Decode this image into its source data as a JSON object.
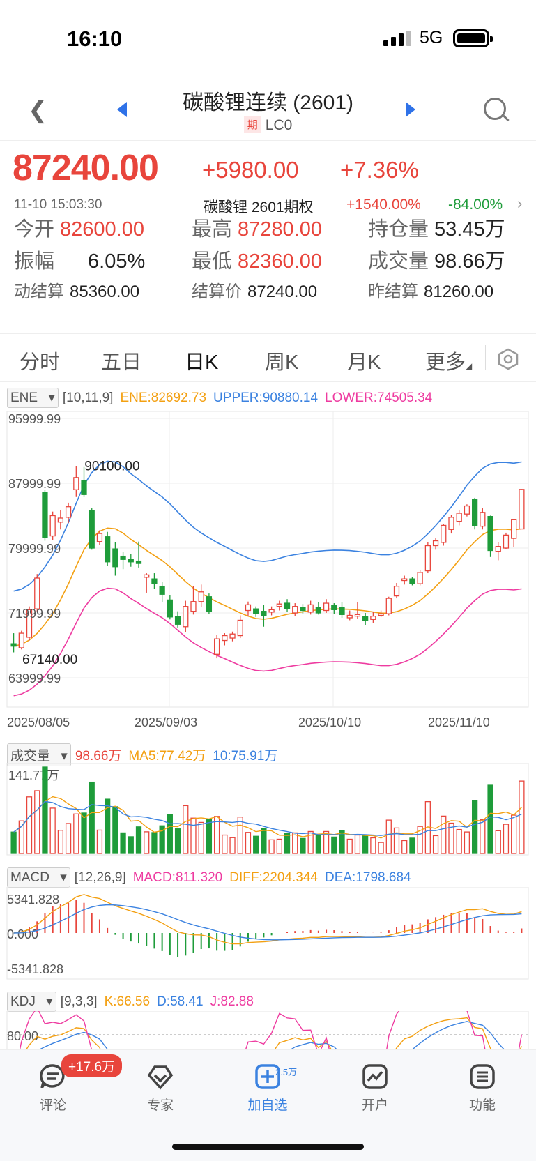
{
  "status_bar": {
    "time": "16:10",
    "network": "5G"
  },
  "header": {
    "title": "碳酸锂连续 (2601)",
    "tag": "期",
    "code": "LC0"
  },
  "quote": {
    "price": "87240.00",
    "change": "+5980.00",
    "change_pct": "+7.36%",
    "timestamp": "11-10 15:03:30",
    "option_name": "碳酸锂 2601期权",
    "option_up": "+1540.00%",
    "option_down": "-84.00%"
  },
  "stats": {
    "open_label": "今开",
    "open": "82600.00",
    "high_label": "最高",
    "high": "87280.00",
    "oi_label": "持仓量",
    "oi": "53.45万",
    "amp_label": "振幅",
    "amp": "6.05%",
    "low_label": "最低",
    "low": "82360.00",
    "vol_label": "成交量",
    "vol": "98.66万",
    "dyn_label": "动结算",
    "dyn": "85360.00",
    "settle_label": "结算价",
    "settle": "87240.00",
    "prev_label": "昨结算",
    "prev": "81260.00"
  },
  "tabs": [
    "分时",
    "五日",
    "日K",
    "周K",
    "月K",
    "更多"
  ],
  "ene": {
    "name": "ENE",
    "params": "[10,11,9]",
    "ene": "ENE:82692.73",
    "upper": "UPPER:90880.14",
    "lower": "LOWER:74505.34",
    "y_labels": [
      "95999.99",
      "87999.99",
      "79999.99",
      "71999.99",
      "63999.99"
    ],
    "max_label": "90100.00",
    "min_label": "67140.00",
    "dates": [
      "2025/08/05",
      "2025/09/03",
      "2025/10/10",
      "2025/11/10"
    ]
  },
  "volume": {
    "name": "成交量",
    "value": "98.66万",
    "ma5": "MA5:77.42万",
    "ma10": "10:75.91万",
    "max_label": "141.77万"
  },
  "macd": {
    "name": "MACD",
    "params": "[12,26,9]",
    "macd": "MACD:811.320",
    "diff": "DIFF:2204.344",
    "dea": "DEA:1798.684",
    "y_labels": [
      "5341.828",
      "0.000",
      "-5341.828"
    ]
  },
  "kdj": {
    "name": "KDJ",
    "params": "[9,3,3]",
    "k": "K:66.56",
    "d": "D:58.41",
    "j": "J:82.88",
    "y_label": "80.00"
  },
  "bottom_nav": {
    "items": [
      "评论",
      "专家",
      "加自选",
      "开户",
      "功能"
    ],
    "comment_badge": "+17.6万",
    "watch_badge": "2.5万"
  },
  "colors": {
    "up": "#e8453c",
    "down": "#1e9c3a",
    "ene": "#f3a012",
    "upper": "#3b82e0",
    "lower": "#ee3ba0",
    "accent": "#2f72e8"
  },
  "chart_data": {
    "type": "candlestick",
    "title": "",
    "ylim": [
      63999.99,
      95999.99
    ],
    "candles": [
      {
        "o": 68200,
        "h": 69500,
        "l": 67140,
        "c": 67900
      },
      {
        "o": 67700,
        "h": 69800,
        "l": 67500,
        "c": 69500
      },
      {
        "o": 69000,
        "h": 72800,
        "l": 68600,
        "c": 72400
      },
      {
        "o": 72500,
        "h": 76800,
        "l": 72100,
        "c": 76300
      },
      {
        "o": 86900,
        "h": 87200,
        "l": 80900,
        "c": 81300
      },
      {
        "o": 81500,
        "h": 84500,
        "l": 81000,
        "c": 84000
      },
      {
        "o": 83200,
        "h": 84700,
        "l": 82300,
        "c": 83700
      },
      {
        "o": 83800,
        "h": 85600,
        "l": 83100,
        "c": 85100
      },
      {
        "o": 87200,
        "h": 90100,
        "l": 86300,
        "c": 88700
      },
      {
        "o": 88300,
        "h": 90000,
        "l": 86300,
        "c": 86600
      },
      {
        "o": 84600,
        "h": 84900,
        "l": 79800,
        "c": 80000
      },
      {
        "o": 80800,
        "h": 82200,
        "l": 80400,
        "c": 81800
      },
      {
        "o": 81400,
        "h": 82000,
        "l": 77800,
        "c": 78300
      },
      {
        "o": 79900,
        "h": 80700,
        "l": 76600,
        "c": 77700
      },
      {
        "o": 79000,
        "h": 79500,
        "l": 77400,
        "c": 78600
      },
      {
        "o": 78600,
        "h": 79300,
        "l": 77700,
        "c": 78300
      },
      {
        "o": 78400,
        "h": 80800,
        "l": 77600,
        "c": 78100
      },
      {
        "o": 76400,
        "h": 76900,
        "l": 74500,
        "c": 76700
      },
      {
        "o": 76200,
        "h": 76900,
        "l": 75000,
        "c": 75600
      },
      {
        "o": 75300,
        "h": 75800,
        "l": 73300,
        "c": 74300
      },
      {
        "o": 73600,
        "h": 74200,
        "l": 71200,
        "c": 71500
      },
      {
        "o": 71600,
        "h": 72200,
        "l": 70200,
        "c": 70600
      },
      {
        "o": 70300,
        "h": 73500,
        "l": 69600,
        "c": 72800
      },
      {
        "o": 72200,
        "h": 75300,
        "l": 71800,
        "c": 73400
      },
      {
        "o": 73400,
        "h": 75500,
        "l": 72700,
        "c": 74600
      },
      {
        "o": 74000,
        "h": 74400,
        "l": 71900,
        "c": 72200
      },
      {
        "o": 66900,
        "h": 69300,
        "l": 66400,
        "c": 68800
      },
      {
        "o": 68600,
        "h": 69500,
        "l": 68000,
        "c": 69200
      },
      {
        "o": 68900,
        "h": 69700,
        "l": 68500,
        "c": 69400
      },
      {
        "o": 69200,
        "h": 71700,
        "l": 68900,
        "c": 71100
      },
      {
        "o": 72300,
        "h": 73400,
        "l": 71600,
        "c": 73000
      },
      {
        "o": 72500,
        "h": 72800,
        "l": 71500,
        "c": 71900
      },
      {
        "o": 72200,
        "h": 73000,
        "l": 70300,
        "c": 71700
      },
      {
        "o": 72100,
        "h": 72800,
        "l": 71700,
        "c": 72400
      },
      {
        "o": 72800,
        "h": 73500,
        "l": 72300,
        "c": 73100
      },
      {
        "o": 73200,
        "h": 73700,
        "l": 72100,
        "c": 72500
      },
      {
        "o": 72000,
        "h": 73200,
        "l": 71600,
        "c": 72800
      },
      {
        "o": 72700,
        "h": 73100,
        "l": 71900,
        "c": 72300
      },
      {
        "o": 72100,
        "h": 73500,
        "l": 71800,
        "c": 73000
      },
      {
        "o": 72700,
        "h": 73300,
        "l": 71800,
        "c": 72000
      },
      {
        "o": 72300,
        "h": 73700,
        "l": 72000,
        "c": 73200
      },
      {
        "o": 72900,
        "h": 73200,
        "l": 71900,
        "c": 72400
      },
      {
        "o": 72700,
        "h": 73300,
        "l": 71400,
        "c": 71800
      },
      {
        "o": 71400,
        "h": 72300,
        "l": 71100,
        "c": 71700
      },
      {
        "o": 71600,
        "h": 73300,
        "l": 71300,
        "c": 71800
      },
      {
        "o": 71600,
        "h": 72000,
        "l": 70500,
        "c": 71100
      },
      {
        "o": 71200,
        "h": 72100,
        "l": 70800,
        "c": 71600
      },
      {
        "o": 71700,
        "h": 72300,
        "l": 71500,
        "c": 71900
      },
      {
        "o": 71900,
        "h": 74000,
        "l": 71700,
        "c": 73800
      },
      {
        "o": 74100,
        "h": 75700,
        "l": 73800,
        "c": 75300
      },
      {
        "o": 76000,
        "h": 76600,
        "l": 75500,
        "c": 76200
      },
      {
        "o": 76200,
        "h": 76400,
        "l": 75400,
        "c": 75600
      },
      {
        "o": 75600,
        "h": 77300,
        "l": 75400,
        "c": 77000
      },
      {
        "o": 77200,
        "h": 80700,
        "l": 76900,
        "c": 80300
      },
      {
        "o": 80300,
        "h": 81200,
        "l": 79800,
        "c": 80900
      },
      {
        "o": 80700,
        "h": 83000,
        "l": 80300,
        "c": 82800
      },
      {
        "o": 82300,
        "h": 84100,
        "l": 81800,
        "c": 83800
      },
      {
        "o": 83300,
        "h": 84700,
        "l": 82800,
        "c": 84300
      },
      {
        "o": 84200,
        "h": 85400,
        "l": 83900,
        "c": 85200
      },
      {
        "o": 86000,
        "h": 86200,
        "l": 82300,
        "c": 82800
      },
      {
        "o": 82700,
        "h": 84900,
        "l": 82300,
        "c": 84400
      },
      {
        "o": 83900,
        "h": 84000,
        "l": 78900,
        "c": 79700
      },
      {
        "o": 79600,
        "h": 80700,
        "l": 78500,
        "c": 80200
      },
      {
        "o": 80000,
        "h": 81900,
        "l": 79900,
        "c": 81600
      },
      {
        "o": 81200,
        "h": 82700,
        "l": 80100,
        "c": 83500
      },
      {
        "o": 82360,
        "h": 87280,
        "l": 82360,
        "c": 87240
      }
    ]
  }
}
